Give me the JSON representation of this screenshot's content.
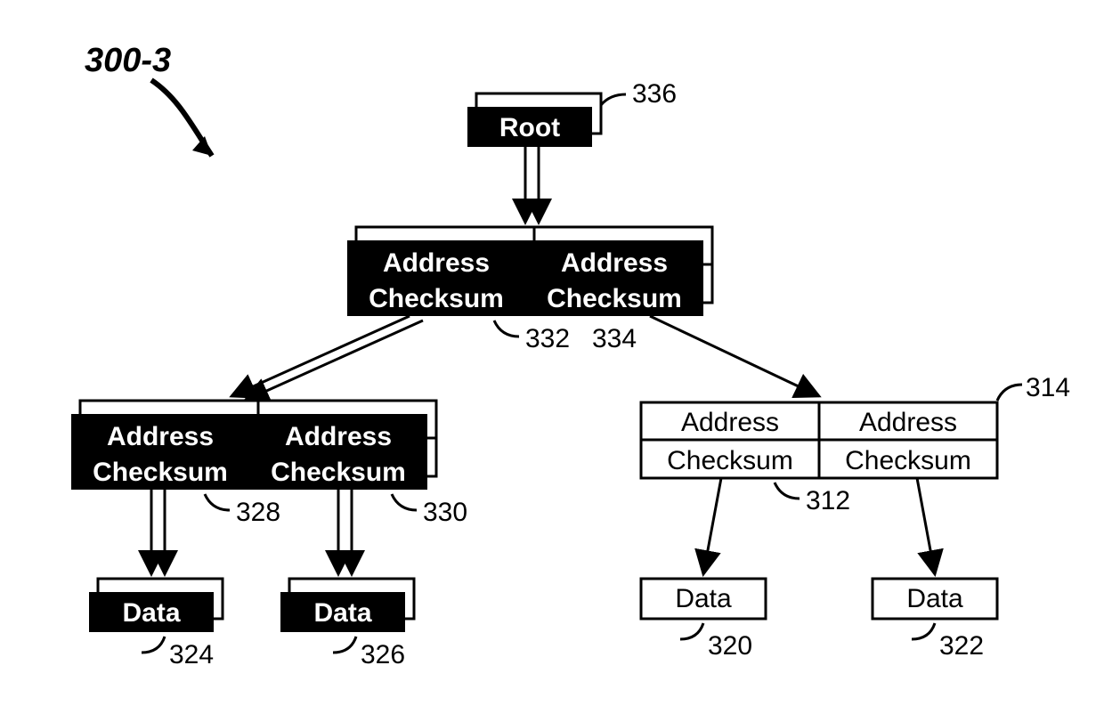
{
  "figure_ref": "300-3",
  "root": {
    "label": "Root",
    "ref": "336"
  },
  "mid": {
    "left": {
      "top": "Address",
      "bot": "Checksum",
      "ref": "332"
    },
    "right": {
      "top": "Address",
      "bot": "Checksum",
      "ref": "334"
    }
  },
  "row3": {
    "leftpair": {
      "l": {
        "top": "Address",
        "bot": "Checksum",
        "ref": "328"
      },
      "r": {
        "top": "Address",
        "bot": "Checksum",
        "ref": "330"
      }
    },
    "rightpair": {
      "l": {
        "top": "Address",
        "bot": "Checksum",
        "ref": "312"
      },
      "r": {
        "top": "Address",
        "bot": "Checksum",
        "ref": "314"
      }
    }
  },
  "data": {
    "l1": {
      "label": "Data",
      "ref": "324"
    },
    "l2": {
      "label": "Data",
      "ref": "326"
    },
    "r1": {
      "label": "Data",
      "ref": "320"
    },
    "r2": {
      "label": "Data",
      "ref": "322"
    }
  }
}
